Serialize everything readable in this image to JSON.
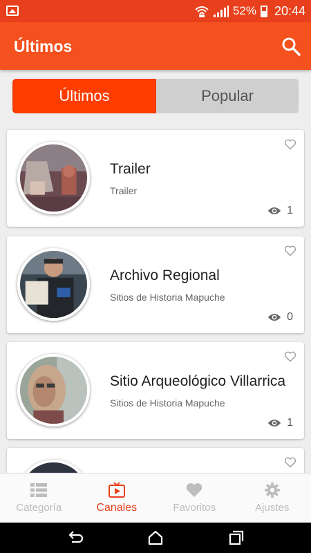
{
  "status_bar": {
    "battery": "52%",
    "time": "20:44"
  },
  "app_bar": {
    "title": "Últimos",
    "search_icon": "search-icon"
  },
  "tabs": [
    {
      "label": "Últimos",
      "active": true
    },
    {
      "label": "Popular",
      "active": false
    }
  ],
  "cards": [
    {
      "title": "Trailer",
      "subtitle": "Trailer",
      "views": "1",
      "thumbnail": "museum-display-photo"
    },
    {
      "title": "Archivo Regional",
      "subtitle": "Sitios de Historia Mapuche",
      "views": "0",
      "thumbnail": "man-with-document-photo"
    },
    {
      "title": "Sitio Arqueológico Villarrica",
      "subtitle": "Sitios de Historia Mapuche",
      "views": "1",
      "thumbnail": "woman-portrait-photo"
    }
  ],
  "bottom_nav": [
    {
      "label": "Categoría",
      "icon": "list-icon",
      "active": false
    },
    {
      "label": "Canales",
      "icon": "tv-icon",
      "active": true
    },
    {
      "label": "Favoritos",
      "icon": "heart-icon",
      "active": false
    },
    {
      "label": "Ajustes",
      "icon": "gear-icon",
      "active": false
    }
  ],
  "colors": {
    "primary": "#f4511e",
    "status_bar": "#e8401c",
    "active_tab": "#ff3d00",
    "inactive_tab": "#cfcfcf"
  }
}
